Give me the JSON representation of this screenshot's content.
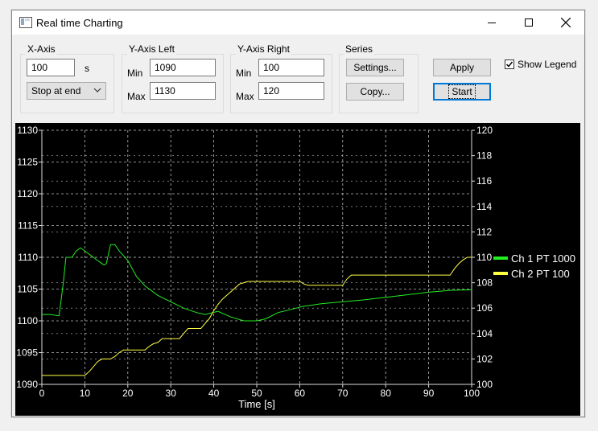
{
  "window": {
    "title": "Real time Charting"
  },
  "xaxis": {
    "group_label": "X-Axis",
    "value": "100",
    "unit": "s",
    "mode": "Stop at end"
  },
  "yleft": {
    "group_label": "Y-Axis Left",
    "min_label": "Min",
    "min": "1090",
    "max_label": "Max",
    "max": "1130"
  },
  "yright": {
    "group_label": "Y-Axis Right",
    "min_label": "Min",
    "min": "100",
    "max_label": "Max",
    "max": "120"
  },
  "series_group": {
    "group_label": "Series",
    "settings_label": "Settings...",
    "copy_label": "Copy..."
  },
  "actions": {
    "apply_label": "Apply",
    "start_label": "Start"
  },
  "legend_toggle": {
    "label": "Show Legend",
    "checked": true
  },
  "colors": {
    "ch1": "#22ee22",
    "ch2": "#ffff44",
    "grid": "#bbbbbb",
    "bg": "#000000"
  },
  "chart_data": {
    "type": "line",
    "xlabel": "Time [s]",
    "xlim": [
      0,
      100
    ],
    "ylim_left": [
      1090,
      1130
    ],
    "ylim_right": [
      100,
      120
    ],
    "x_ticks": [
      "0",
      "10",
      "20",
      "30",
      "40",
      "50",
      "60",
      "70",
      "80",
      "90",
      "100"
    ],
    "y_left_ticks": [
      "1090",
      "1095",
      "1100",
      "1105",
      "1110",
      "1115",
      "1120",
      "1125",
      "1130"
    ],
    "y_right_ticks": [
      "100",
      "102",
      "104",
      "106",
      "108",
      "110",
      "112",
      "114",
      "116",
      "118",
      "120"
    ],
    "grid": true,
    "legend_position": "right",
    "series": [
      {
        "name": "Ch 1 PT 1000",
        "axis": "left",
        "x": [
          0,
          2,
          4,
          5,
          5.6,
          7,
          8,
          9,
          10,
          12,
          13,
          14,
          14.5,
          15,
          16,
          17,
          18,
          20,
          22,
          24,
          27,
          30,
          33,
          36,
          38,
          41,
          44,
          47,
          48,
          50,
          52,
          55,
          58,
          61,
          65,
          70,
          75,
          80,
          85,
          90,
          95,
          100
        ],
        "y": [
          1101,
          1101,
          1100.8,
          1106,
          1110,
          1110,
          1111,
          1111.5,
          1111,
          1110,
          1109.5,
          1109,
          1108.8,
          1109,
          1112,
          1112,
          1111,
          1109.5,
          1107,
          1105.5,
          1104,
          1103,
          1102,
          1101.3,
          1101,
          1101.5,
          1100.6,
          1100,
          1100,
          1100,
          1100.3,
          1101.3,
          1101.8,
          1102.3,
          1102.7,
          1103,
          1103.3,
          1103.7,
          1104.1,
          1104.5,
          1104.8,
          1104.9
        ]
      },
      {
        "name": "Ch 2 PT 100",
        "axis": "right",
        "x": [
          0,
          3,
          6,
          10,
          11,
          12,
          13,
          14,
          15,
          16,
          17,
          18,
          19,
          21,
          22,
          24,
          25,
          26,
          27,
          28,
          30,
          32,
          33,
          34,
          37,
          38,
          39,
          40,
          41,
          42,
          43,
          44,
          45,
          46,
          47,
          48,
          50,
          55,
          60,
          61,
          62,
          65,
          70,
          71,
          72,
          75,
          80,
          85,
          90,
          94,
          95,
          96,
          97,
          98,
          99,
          100
        ],
        "y": [
          100.7,
          100.7,
          100.7,
          100.7,
          101,
          101.4,
          101.8,
          102,
          102,
          102,
          102.2,
          102.5,
          102.7,
          102.7,
          102.7,
          102.7,
          103,
          103.2,
          103.3,
          103.6,
          103.6,
          103.6,
          104,
          104.4,
          104.4,
          104.8,
          105.2,
          105.8,
          106.3,
          106.7,
          107,
          107.3,
          107.6,
          107.9,
          108,
          108.1,
          108.1,
          108.1,
          108.1,
          107.9,
          107.8,
          107.8,
          107.8,
          108.3,
          108.6,
          108.6,
          108.6,
          108.6,
          108.6,
          108.6,
          108.6,
          109.1,
          109.5,
          109.8,
          110,
          110
        ]
      }
    ]
  }
}
